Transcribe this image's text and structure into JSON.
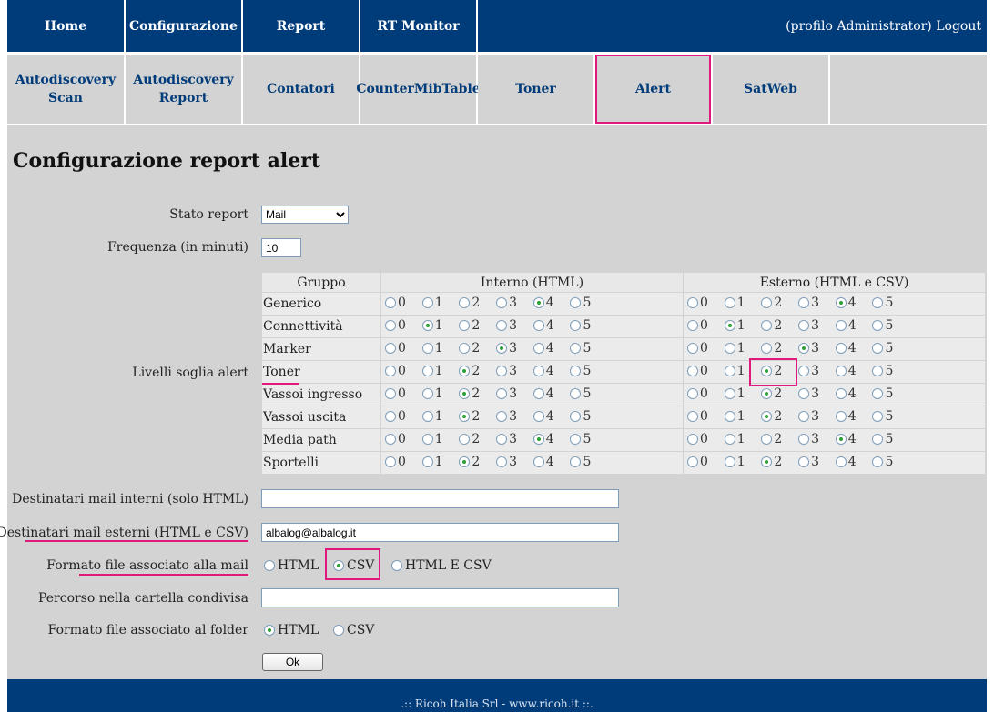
{
  "nav": {
    "items": [
      "Home",
      "Configurazione",
      "Report",
      "RT Monitor"
    ],
    "profile": "(profilo Administrator)",
    "logout": "Logout"
  },
  "subnav": {
    "items": [
      "Autodiscovery Scan",
      "Autodiscovery Report",
      "Contatori",
      "CounterMibTable",
      "Toner",
      "Alert",
      "SatWeb",
      ""
    ],
    "active": "Alert"
  },
  "page": {
    "title": "Configurazione report alert",
    "stato_report_label": "Stato report",
    "stato_report_value": "Mail",
    "frequenza_label": "Frequenza (in minuti)",
    "frequenza_value": "10",
    "livelli_label": "Livelli soglia alert",
    "dest_interni_label": "Destinatari mail interni (solo HTML)",
    "dest_interni_value": "",
    "dest_esterni_label": "Destinatari mail esterni (HTML e CSV)",
    "dest_esterni_value": "albalog@albalog.it",
    "formato_mail_label": "Formato file associato alla mail",
    "formato_mail_options": [
      "HTML",
      "CSV",
      "HTML E CSV"
    ],
    "formato_mail_selected": "CSV",
    "percorso_label": "Percorso nella cartella condivisa",
    "percorso_value": "",
    "formato_folder_label": "Formato file associato al folder",
    "formato_folder_options": [
      "HTML",
      "CSV"
    ],
    "formato_folder_selected": "HTML",
    "ok_label": "Ok"
  },
  "table": {
    "headers": [
      "Gruppo",
      "Interno (HTML)",
      "Esterno (HTML e CSV)"
    ],
    "levels": [
      "0",
      "1",
      "2",
      "3",
      "4",
      "5"
    ],
    "rows": [
      {
        "group": "Generico",
        "interno": 4,
        "esterno": 4
      },
      {
        "group": "Connettività",
        "interno": 1,
        "esterno": 1
      },
      {
        "group": "Marker",
        "interno": 3,
        "esterno": 3
      },
      {
        "group": "Toner",
        "interno": 2,
        "esterno": 2
      },
      {
        "group": "Vassoi ingresso",
        "interno": 2,
        "esterno": 2
      },
      {
        "group": "Vassoi uscita",
        "interno": 2,
        "esterno": 2
      },
      {
        "group": "Media path",
        "interno": 4,
        "esterno": 4
      },
      {
        "group": "Sportelli",
        "interno": 2,
        "esterno": 2
      }
    ]
  },
  "footer": {
    "text": ".:: Ricoh Italia Srl - www.ricoh.it ::."
  },
  "colors": {
    "nav_bg": "#003b7a",
    "panel_bg": "#d3d3d3",
    "highlight": "#e0197d",
    "radio_dot": "#2e9e36"
  }
}
